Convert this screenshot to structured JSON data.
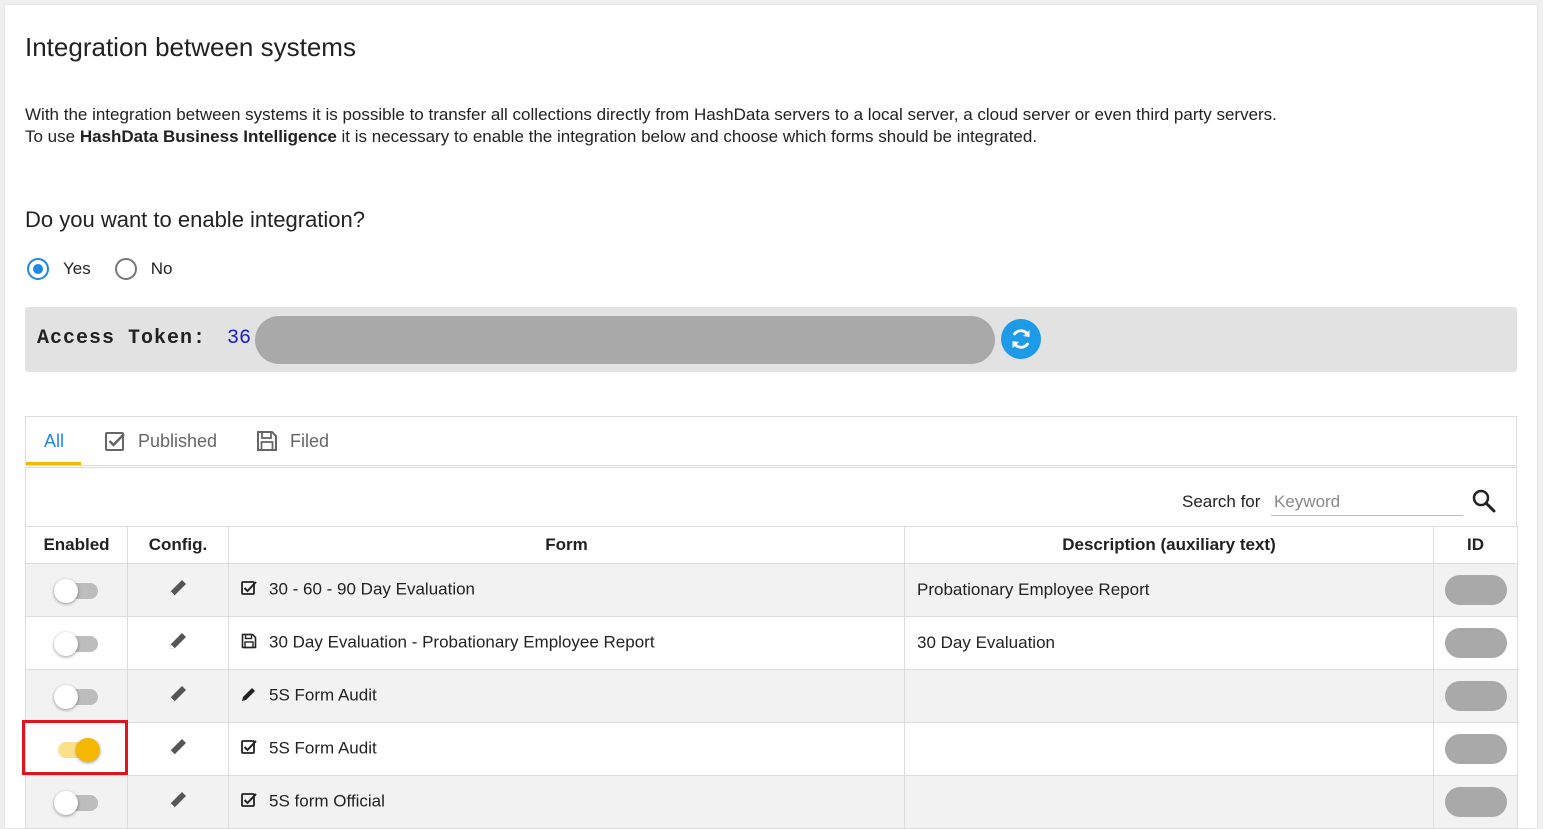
{
  "page": {
    "title": "Integration between systems",
    "intro_line1": "With the integration between systems it is possible to transfer all collections directly from HashData servers to a local server, a cloud server or even third party servers.",
    "intro_line2_pre": "To use ",
    "intro_line2_bold": "HashData Business Intelligence",
    "intro_line2_post": " it is necessary to enable the integration below and choose which forms should be integrated."
  },
  "integration": {
    "question": "Do you want to enable integration?",
    "options": [
      {
        "label": "Yes",
        "checked": true
      },
      {
        "label": "No",
        "checked": false
      }
    ]
  },
  "token": {
    "label": "Access Token:",
    "value_visible": "36",
    "refresh_icon": "refresh-icon",
    "accent_color": "#1e9be8"
  },
  "tabs": [
    {
      "label": "All",
      "icon": "",
      "active": true
    },
    {
      "label": "Published",
      "icon": "checkbox-icon",
      "active": false
    },
    {
      "label": "Filed",
      "icon": "save-icon",
      "active": false
    }
  ],
  "search": {
    "label": "Search for",
    "placeholder": "Keyword",
    "icon": "search-icon"
  },
  "table": {
    "columns": [
      "Enabled",
      "Config.",
      "Form",
      "Description (auxiliary text)",
      "ID"
    ],
    "rows": [
      {
        "enabled": false,
        "form_icon": "checkbox-icon",
        "form": "30 - 60 - 90 Day Evaluation",
        "description": "Probationary Employee Report"
      },
      {
        "enabled": false,
        "form_icon": "save-icon",
        "form": "30 Day Evaluation - Probationary Employee Report",
        "description": "30 Day Evaluation"
      },
      {
        "enabled": false,
        "form_icon": "pencil-icon",
        "form": "5S Form Audit",
        "description": ""
      },
      {
        "enabled": true,
        "form_icon": "checkbox-icon",
        "form": "5S Form Audit",
        "description": ""
      },
      {
        "enabled": false,
        "form_icon": "checkbox-icon",
        "form": "5S form Official",
        "description": ""
      }
    ]
  },
  "colors": {
    "primary": "#1e88e5",
    "toggle_on": "#f5b700",
    "highlight": "#e0141e"
  }
}
